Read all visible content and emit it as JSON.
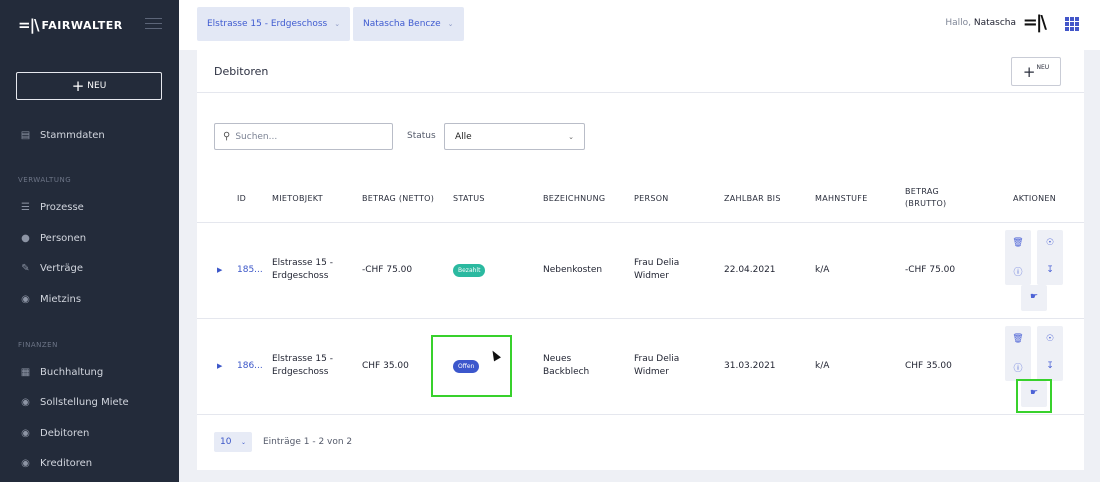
{
  "app": {
    "brand": "FAIRWALTER",
    "new_label": "NEU"
  },
  "sidebar": {
    "items": [
      {
        "label": "Stammdaten",
        "icon": "database-icon"
      }
    ],
    "sections": [
      {
        "title": "VERWALTUNG",
        "items": [
          {
            "label": "Prozesse",
            "icon": "list-icon"
          },
          {
            "label": "Personen",
            "icon": "people-icon"
          },
          {
            "label": "Verträge",
            "icon": "contract-icon"
          },
          {
            "label": "Mietzins",
            "icon": "coins-icon"
          }
        ]
      },
      {
        "title": "FINANZEN",
        "items": [
          {
            "label": "Buchhaltung",
            "icon": "ledger-icon"
          },
          {
            "label": "Sollstellung Miete",
            "icon": "coins-icon"
          },
          {
            "label": "Debitoren",
            "icon": "coins-icon"
          },
          {
            "label": "Kreditoren",
            "icon": "coins-icon"
          }
        ]
      }
    ]
  },
  "topbar": {
    "property": "Elstrasse 15 - Erdgeschoss",
    "person": "Natascha Bencze",
    "greeting": "Hallo,",
    "user": "Natascha"
  },
  "page": {
    "title": "Debitoren",
    "new_label": "NEU",
    "search_placeholder": "Suchen...",
    "status_label": "Status",
    "status_value": "Alle"
  },
  "table": {
    "headers": {
      "id": "ID",
      "mietobjekt": "MIETOBJEKT",
      "betrag_netto": "BETRAG (NETTO)",
      "status": "STATUS",
      "bezeichnung": "BEZEICHNUNG",
      "person": "PERSON",
      "zahlbar_bis": "ZAHLBAR BIS",
      "mahnstufe": "MAHNSTUFE",
      "betrag_brutto_1": "BETRAG",
      "betrag_brutto_2": "(BRUTTO)",
      "aktionen": "AKTIONEN"
    },
    "rows": [
      {
        "id": "185...",
        "mietobjekt_1": "Elstrasse 15 -",
        "mietobjekt_2": "Erdgeschoss",
        "betrag_netto": "-CHF 75.00",
        "status": "Bezahlt",
        "bezeichnung_1": "Nebenkosten",
        "bezeichnung_2": "",
        "person_1": "Frau Delia",
        "person_2": "Widmer",
        "zahlbar_bis": "22.04.2021",
        "mahnstufe": "k/A",
        "betrag_brutto": "-CHF 75.00"
      },
      {
        "id": "186...",
        "mietobjekt_1": "Elstrasse 15 -",
        "mietobjekt_2": "Erdgeschoss",
        "betrag_netto": "CHF 35.00",
        "status": "Offen",
        "bezeichnung_1": "Neues",
        "bezeichnung_2": "Backblech",
        "person_1": "Frau Delia",
        "person_2": "Widmer",
        "zahlbar_bis": "31.03.2021",
        "mahnstufe": "k/A",
        "betrag_brutto": "CHF 35.00"
      }
    ]
  },
  "pagination": {
    "page_size": "10",
    "entries": "Einträge 1 - 2 von 2"
  }
}
